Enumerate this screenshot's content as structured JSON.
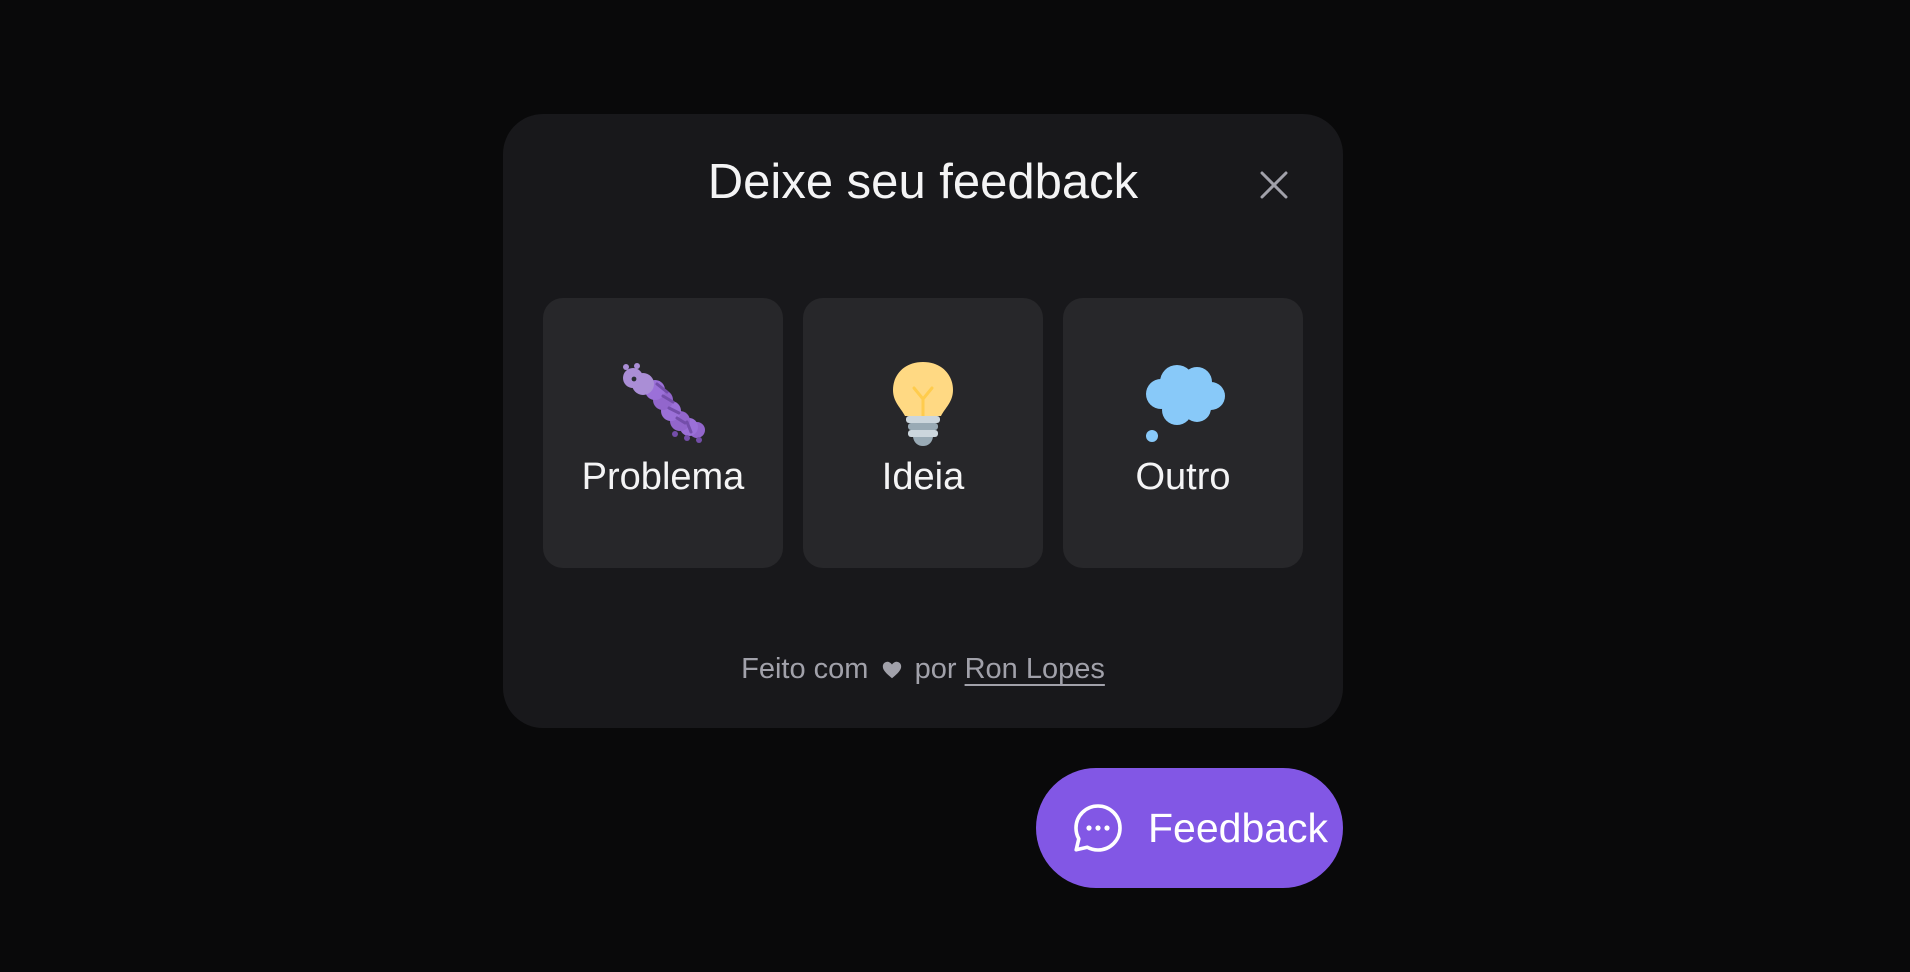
{
  "widget": {
    "title": "Deixe seu feedback",
    "close_icon": "close-icon",
    "options": [
      {
        "label": "Problema",
        "icon": "bug-icon"
      },
      {
        "label": "Ideia",
        "icon": "lightbulb-icon"
      },
      {
        "label": "Outro",
        "icon": "thought-balloon-icon"
      }
    ],
    "footer": {
      "prefix": "Feito com",
      "heart_icon": "heart-icon",
      "middle": "por",
      "author": "Ron Lopes"
    }
  },
  "feedback_button": {
    "label": "Feedback",
    "icon": "chat-bubble-icon"
  },
  "colors": {
    "background": "#09090a",
    "surface": "#18181b",
    "card": "#27272a",
    "brand": "#8257e5",
    "text": "#f4f4f5",
    "muted": "#a1a1aa"
  }
}
